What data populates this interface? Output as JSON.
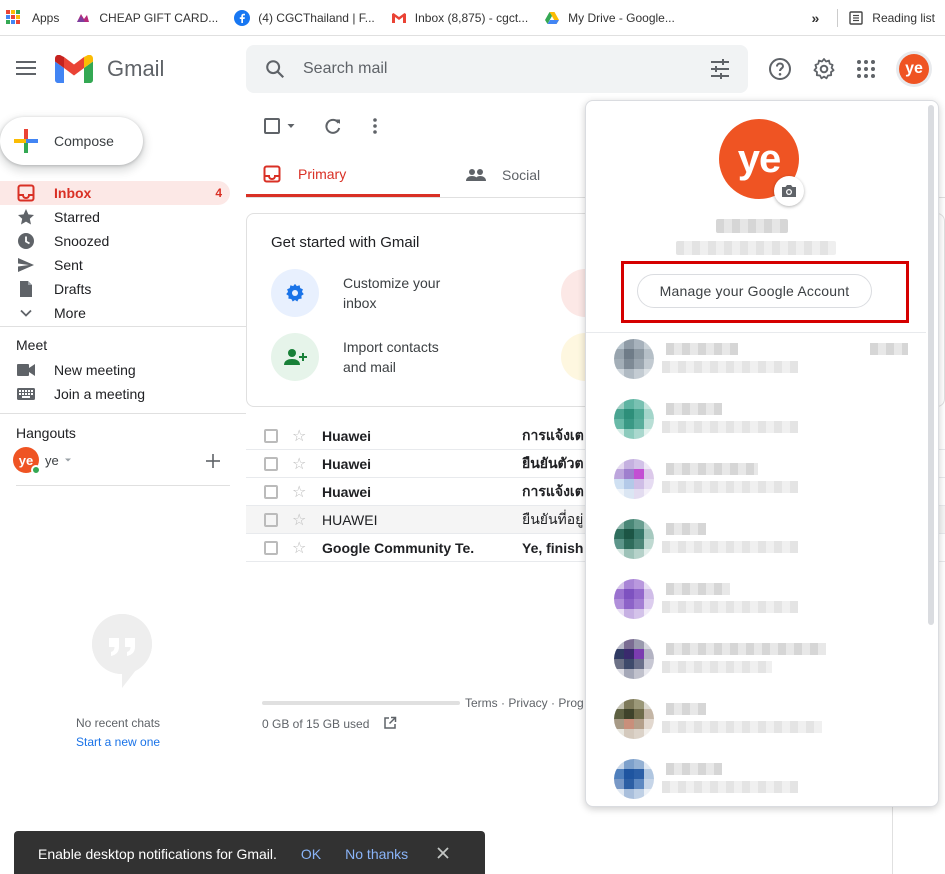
{
  "bookmarks": {
    "apps": "Apps",
    "items": [
      "CHEAP GIFT CARD...",
      "(4) CGCThailand | F...",
      "Inbox (8,875) - cgct...",
      "My Drive - Google..."
    ],
    "overflow": "»",
    "reading_list": "Reading list"
  },
  "header": {
    "logo_text": "Gmail",
    "search_placeholder": "Search mail",
    "avatar_initials": "ye"
  },
  "sidebar": {
    "compose": "Compose",
    "items": [
      {
        "label": "Inbox",
        "count": "4"
      },
      {
        "label": "Starred"
      },
      {
        "label": "Snoozed"
      },
      {
        "label": "Sent"
      },
      {
        "label": "Drafts"
      },
      {
        "label": "More"
      }
    ],
    "meet_title": "Meet",
    "meet_items": [
      "New meeting",
      "Join a meeting"
    ],
    "hangouts_title": "Hangouts",
    "hangout_user": "ye",
    "no_chats": "No recent chats",
    "start_new": "Start a new one"
  },
  "main": {
    "tabs": [
      "Primary",
      "Social"
    ],
    "card_title": "Get started with Gmail",
    "card_items": [
      {
        "line1": "Customize your",
        "line2": "inbox"
      },
      {
        "line1": "Import contacts",
        "line2": "and mail"
      }
    ],
    "emails": [
      {
        "sender": "Huawei",
        "subject": "การแจ้งเต",
        "read": false
      },
      {
        "sender": "Huawei",
        "subject": "ยืนยันตัวต",
        "read": false
      },
      {
        "sender": "Huawei",
        "subject": "การแจ้งเต",
        "read": false
      },
      {
        "sender": "HUAWEI",
        "subject": "ยืนยันที่อยู่",
        "read": true
      },
      {
        "sender": "Google Community Te.",
        "subject": "Ye, finish",
        "read": false
      }
    ],
    "storage": "0 GB of 15 GB used",
    "terms": "Terms · Privacy · Prog"
  },
  "account_popup": {
    "avatar_initials": "ye",
    "manage_button": "Manage your Google Account"
  },
  "toast": {
    "message": "Enable desktop notifications for Gmail.",
    "ok": "OK",
    "no_thanks": "No thanks"
  }
}
